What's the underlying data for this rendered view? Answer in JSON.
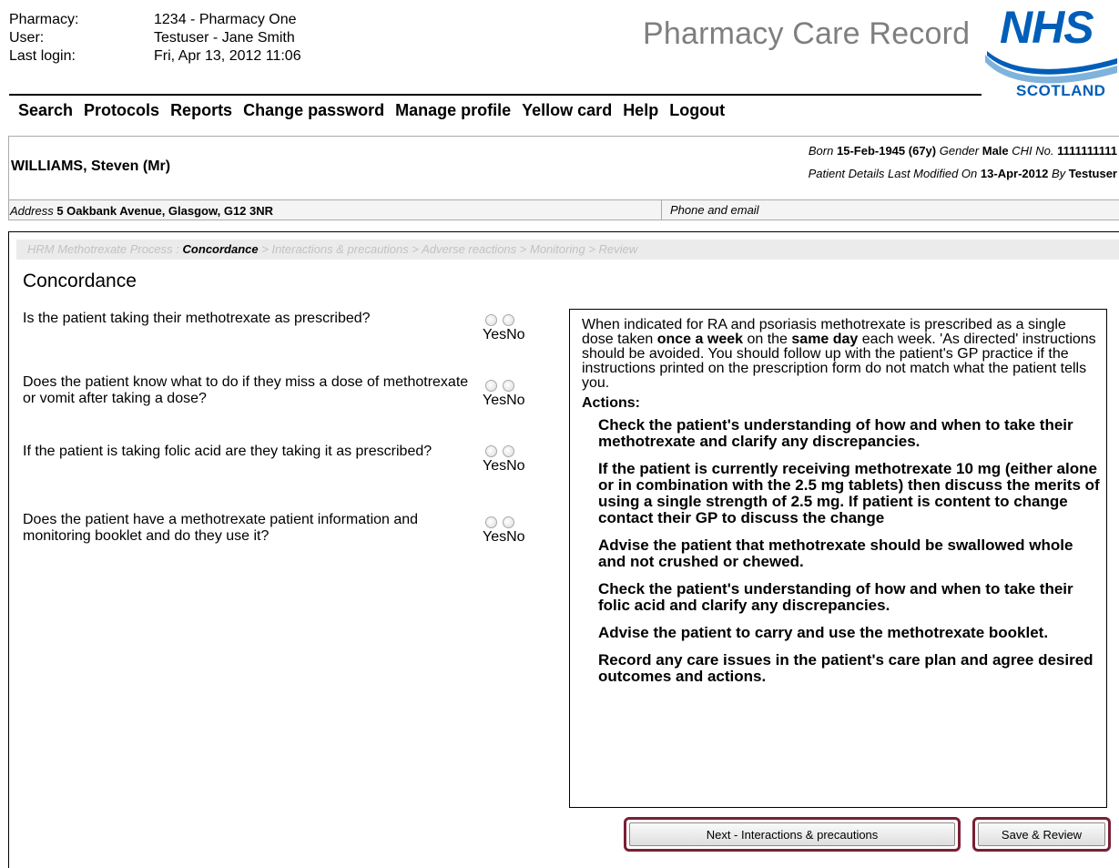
{
  "user_info": {
    "pharmacy_label": "Pharmacy:",
    "pharmacy_value": "1234 - Pharmacy One",
    "user_label": "User:",
    "user_value": "Testuser - Jane Smith",
    "last_login_label": "Last login:",
    "last_login_value": "Fri, Apr 13, 2012 11:06"
  },
  "app_title": "Pharmacy Care Record",
  "logo": {
    "nhs": "NHS",
    "region": "SCOTLAND",
    "brand_color": "#005eb8"
  },
  "nav": [
    "Search",
    "Protocols",
    "Reports",
    "Change password",
    "Manage profile",
    "Yellow card",
    "Help",
    "Logout"
  ],
  "patient": {
    "name": "WILLIAMS, Steven (Mr)",
    "born_label": "Born",
    "born": "15-Feb-1945",
    "age": "(67y)",
    "gender_label": "Gender",
    "gender": "Male",
    "chi_label": "CHI No.",
    "chi": "1111111111",
    "modified_label": "Patient Details Last Modified On",
    "modified_date": "13-Apr-2012",
    "by_label": "By",
    "modified_by": "Testuser",
    "address_label": "Address",
    "address": "5 Oakbank Avenue, Glasgow, G12 3NR",
    "phone_label": "Phone and email"
  },
  "breadcrumb": {
    "process": "HRM Methotrexate Process",
    "separator": ":",
    "current": "Concordance",
    "steps": [
      "Interactions & precautions",
      "Adverse reactions",
      "Monitoring",
      "Review"
    ]
  },
  "section_title": "Concordance",
  "radio_yes": "Yes",
  "radio_no": "No",
  "questions": [
    "Is the patient taking their methotrexate as prescribed?",
    "Does the patient know what to do if they miss a dose of methotrexate or vomit after taking a dose?",
    "If the patient is taking folic acid are they taking it as prescribed?",
    "Does the patient have a methotrexate patient information and monitoring booklet and do they use it?"
  ],
  "guidance": {
    "intro_1": "When indicated for RA and psoriasis methotrexate is prescribed as a single dose taken ",
    "intro_bold_1": "once a week",
    "intro_2": " on the ",
    "intro_bold_2": "same day",
    "intro_3": " each week. 'As directed' instructions should be avoided. You should follow up with the patient's GP practice if the instructions printed on the prescription form do not match what the patient tells you.",
    "actions_heading": "Actions:",
    "actions": [
      "Check the patient's understanding of how and when to take their methotrexate and clarify any discrepancies.",
      "If the patient is currently receiving methotrexate 10 mg (either alone or in combination with the 2.5 mg tablets) then discuss the merits of using a single strength of 2.5 mg. If patient is content to change contact their GP to discuss the change",
      "Advise the patient that methotrexate should be swallowed whole and not crushed or chewed.",
      "Check the patient's understanding of how and when to take their folic acid and clarify any discrepancies.",
      "Advise the patient to carry and use the methotrexate booklet.",
      "Record any care issues in the patient's care plan and agree desired outcomes and actions."
    ]
  },
  "buttons": {
    "next": "Next - Interactions & precautions",
    "save": "Save & Review"
  }
}
